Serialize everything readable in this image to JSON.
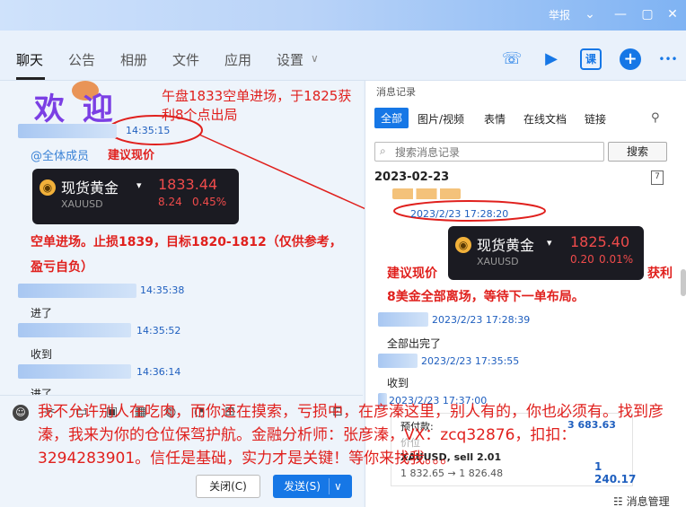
{
  "window": {
    "title": "",
    "report_label": "举报",
    "min_icon": "—",
    "restore_icon": "▢",
    "close_icon": "✕",
    "menu_icon": "⌄"
  },
  "tabs": [
    {
      "label": "聊天"
    },
    {
      "label": "公告"
    },
    {
      "label": "相册"
    },
    {
      "label": "文件"
    },
    {
      "label": "应用"
    },
    {
      "label": "设置"
    }
  ],
  "toolbar": {
    "phone_icon": "☏",
    "video_icon": "▶",
    "class_label": "课",
    "add_icon": "+",
    "more_icon": "•••"
  },
  "chat": {
    "welcome_text": "欢 迎",
    "annotation_title": "午盘1833空单进场，于1825获利8个点出局",
    "messages": [
      {
        "time": "14:35:15"
      },
      {
        "time": "14:35:38",
        "text": "进了"
      },
      {
        "time": "14:35:52",
        "text": "收到"
      },
      {
        "time": "14:36:14",
        "text": "进了"
      }
    ],
    "mention": "@全体成员",
    "suggest": "建议现价",
    "signal": "空单进场。止损1839，目标1820-1812（仅供参考，盈亏自负）"
  },
  "gold_card_chat": {
    "name": "现货黄金",
    "caret": "▾",
    "symbol": "XAUUSD",
    "price": "1833.44",
    "change": "8.24",
    "pct": "0.45%",
    "icon_glyph": "◉"
  },
  "history": {
    "title": "消息记录",
    "filters": [
      "全部",
      "图片/视频",
      "表情",
      "在线文档",
      "链接"
    ],
    "filter_icon": "⚲",
    "search_placeholder": "搜索消息记录",
    "search_icon": "⌕",
    "search_button": "搜索",
    "date": "2023-02-23",
    "calendar_glyph": "7",
    "ts1": "2023/2/23 17:28:20",
    "suggest": "建议现价",
    "profit": "获利",
    "exit_text": "8美金全部离场，等待下一单布局。",
    "ts2": "2023/2/23 17:28:39",
    "msg2": "全部出完了",
    "ts3": "2023/2/23 17:35:55",
    "msg3": "收到",
    "ts4": "2023/2/23 17:37:00",
    "quote": {
      "prepay_label": "预付款:",
      "prepay_value": "3 683.63",
      "price_label": "价位",
      "symbol_line": "XAUUSD, sell 2.01",
      "range": "1 832.65 → 1 826.48",
      "profit_value": "1 240.17"
    },
    "manage_label": "消息管理",
    "manage_icon": "☷"
  },
  "gold_card_history": {
    "name": "现货黄金",
    "caret": "▾",
    "symbol": "XAUUSD",
    "price": "1825.40",
    "change": "0.20",
    "pct": "0.01%",
    "icon_glyph": "◉"
  },
  "input": {
    "emoji_icon": "☺",
    "close_button": "关闭(C)",
    "send_button": "发送(S)",
    "send_caret": "∨"
  },
  "overlay_ad": "我不允许别人在吃肉，而你还在摸索，亏损中，在彦溱这里，别人有的，你也必须有。找到彦溱，我来为你的仓位保驾护航。金融分析师：张彦溱，VX：zcq32876，扣扣：3294283901。信任是基础，实力才是关键！等你来找我。。。"
}
